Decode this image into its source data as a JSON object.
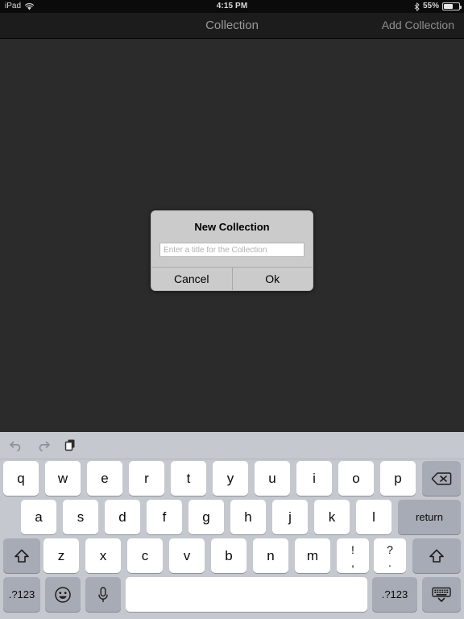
{
  "status_bar": {
    "device_label": "iPad",
    "wifi_icon": "wifi-icon",
    "time": "4:15 PM",
    "bluetooth_icon": "bluetooth-icon",
    "battery_percent": "55%",
    "battery_level": 55
  },
  "nav_bar": {
    "title": "Collection",
    "action_label": "Add Collection"
  },
  "alert": {
    "title": "New Collection",
    "input_value": "",
    "input_placeholder": "Enter a title for the Collection",
    "cancel_label": "Cancel",
    "ok_label": "Ok"
  },
  "keyboard": {
    "toolbar": {
      "undo_icon": "undo-icon",
      "redo_icon": "redo-icon",
      "paste_icon": "paste-icon"
    },
    "row1": [
      "q",
      "w",
      "e",
      "r",
      "t",
      "y",
      "u",
      "i",
      "o",
      "p"
    ],
    "backspace_icon": "backspace-icon",
    "row2": [
      "a",
      "s",
      "d",
      "f",
      "g",
      "h",
      "j",
      "k",
      "l"
    ],
    "return_label": "return",
    "row3": [
      "z",
      "x",
      "c",
      "v",
      "b",
      "n",
      "m"
    ],
    "shift_left_icon": "shift-icon",
    "shift_right_icon": "shift-icon",
    "punct_keys": [
      {
        "top": "!",
        "bot": ","
      },
      {
        "top": "?",
        "bot": "."
      }
    ],
    "numbers_left_label": ".?123",
    "numbers_right_label": ".?123",
    "emoji_icon": "emoji-icon",
    "dictation_icon": "microphone-icon",
    "space_label": "",
    "hide_keyboard_icon": "hide-keyboard-icon"
  },
  "colors": {
    "content_bg": "#2b2b2b",
    "nav_bg": "#1c1c1c",
    "status_bg": "#0b0b0b",
    "keyboard_bg": "#c5c8ce",
    "key_light": "#ffffff",
    "key_dark": "#a6abb5",
    "alert_bg": "#cbcbcb"
  }
}
